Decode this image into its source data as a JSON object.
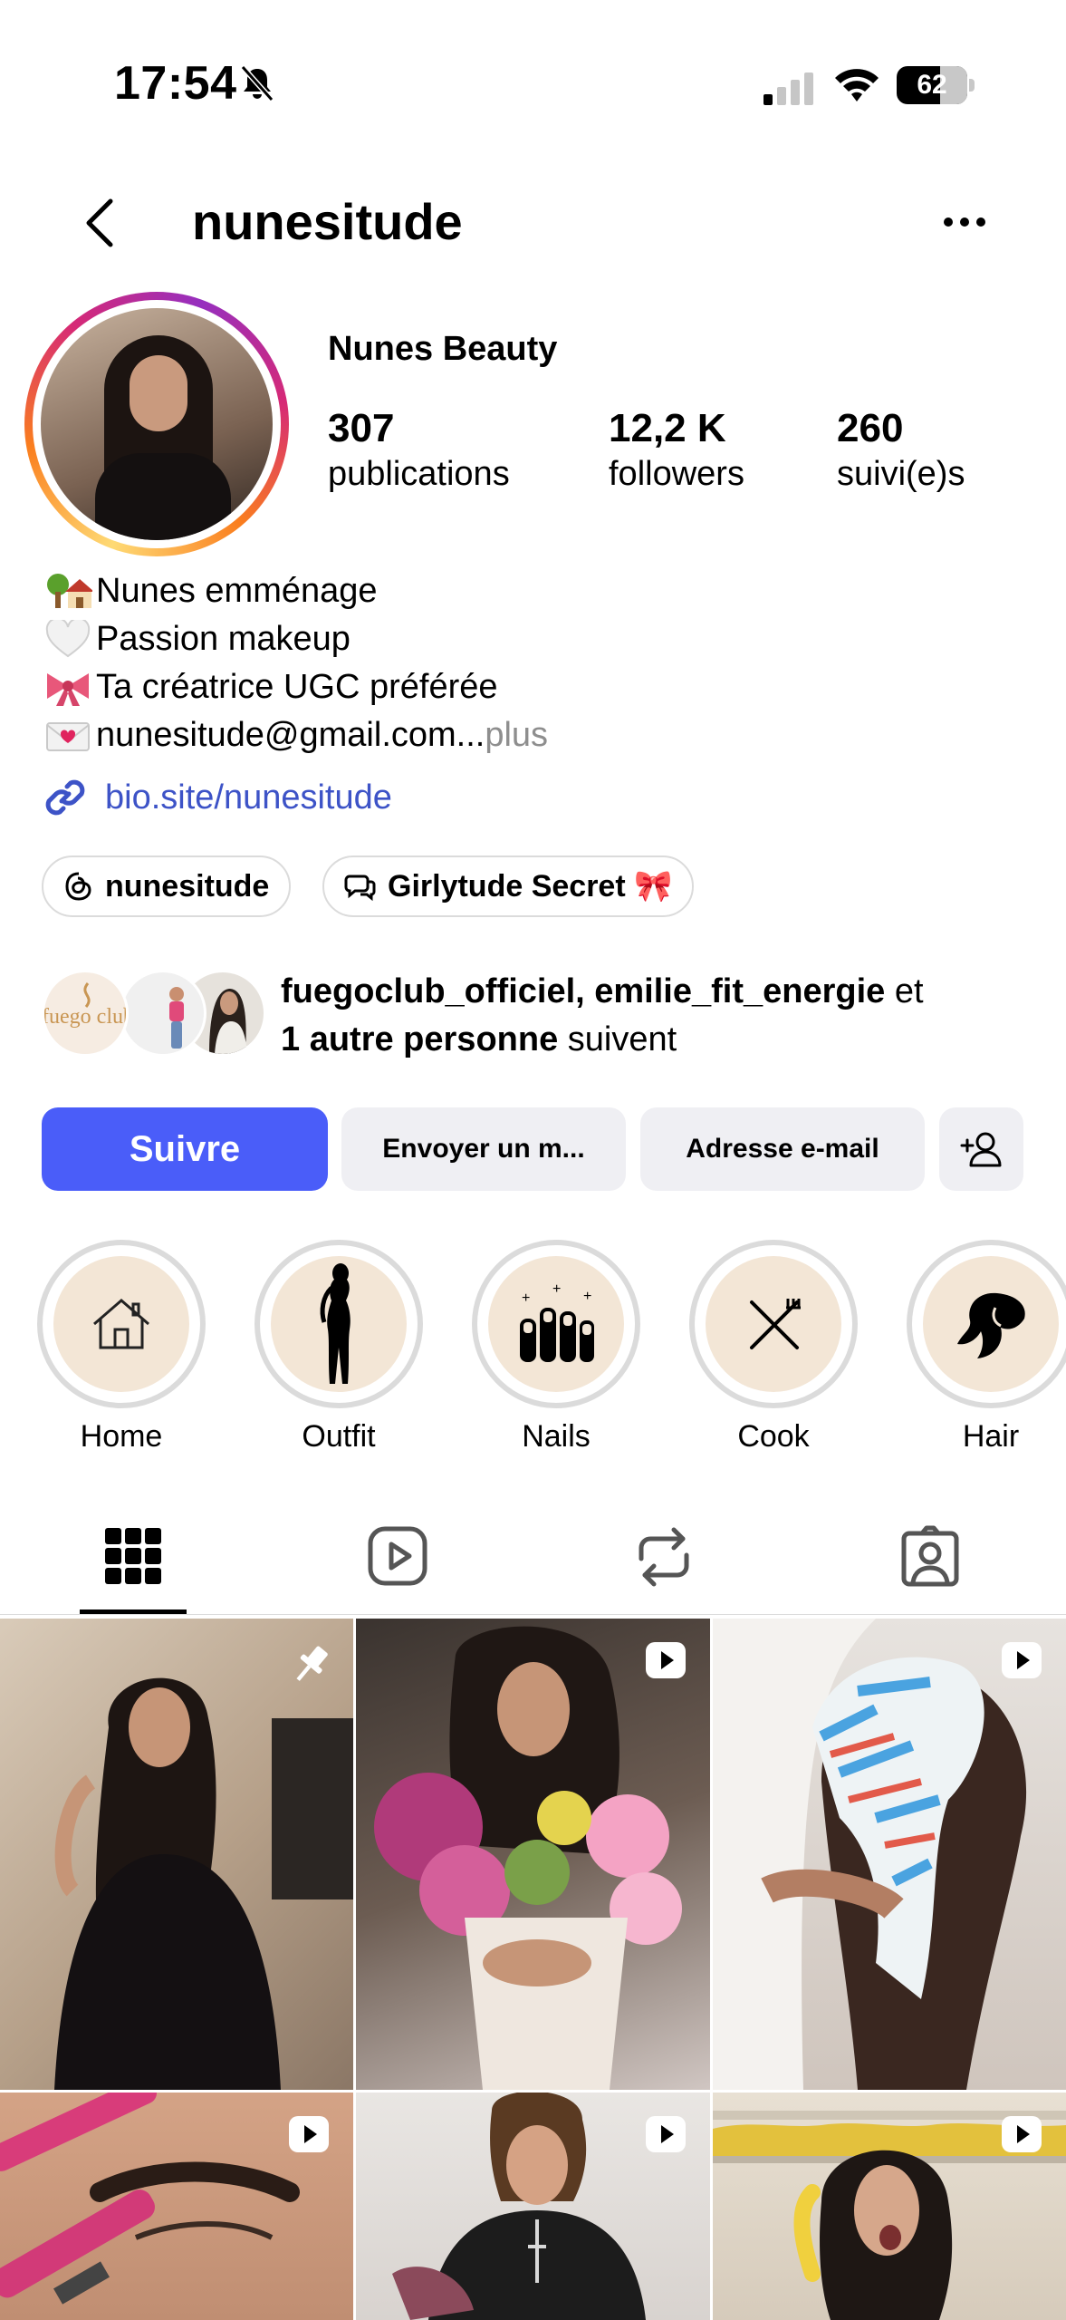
{
  "status_bar": {
    "time": "17:54",
    "battery_level": "62",
    "battery_fraction": 0.62
  },
  "header": {
    "username": "nunesitude"
  },
  "profile": {
    "display_name": "Nunes Beauty",
    "stats": [
      {
        "number": "307",
        "label": "publications"
      },
      {
        "number": "12,2 K",
        "label": "followers"
      },
      {
        "number": "260",
        "label": "suivi(e)s"
      }
    ],
    "bio": [
      {
        "emoji": "house-tree",
        "text": "Nunes emménage"
      },
      {
        "emoji": "white-heart",
        "text": " Passion makeup"
      },
      {
        "emoji": "ribbon",
        "text": " Ta créatrice UGC préférée"
      },
      {
        "emoji": "love-letter",
        "text": " nunesitude@gmail.com..."
      }
    ],
    "bio_more": " plus",
    "link": "bio.site/nunesitude",
    "chips": [
      {
        "label": "nunesitude",
        "icon": "threads-icon"
      },
      {
        "label": "Girlytude Secret 🎀",
        "icon": "chat-bubbles-icon"
      }
    ],
    "mutual": {
      "names": "fuegoclub_officiel, emilie_fit_energie",
      "connector": " et",
      "others": "1 autre personne",
      "suffix": " suivent",
      "logo_text": "fuego club"
    }
  },
  "actions": {
    "follow": "Suivre",
    "message": "Envoyer un m...",
    "email": "Adresse e-mail"
  },
  "highlights": [
    {
      "label": "Home",
      "icon": "house-icon"
    },
    {
      "label": "Outfit",
      "icon": "woman-silhouette-icon"
    },
    {
      "label": "Nails",
      "icon": "nails-icon"
    },
    {
      "label": "Cook",
      "icon": "fork-knife-icon"
    },
    {
      "label": "Hair",
      "icon": "hair-icon"
    }
  ],
  "tabs": [
    "grid-icon",
    "reels-icon",
    "reposts-icon",
    "tagged-icon"
  ],
  "colors": {
    "accent": "#4a5df9",
    "link": "#3d53c7",
    "highlight_bg": "#f3e6d6"
  }
}
